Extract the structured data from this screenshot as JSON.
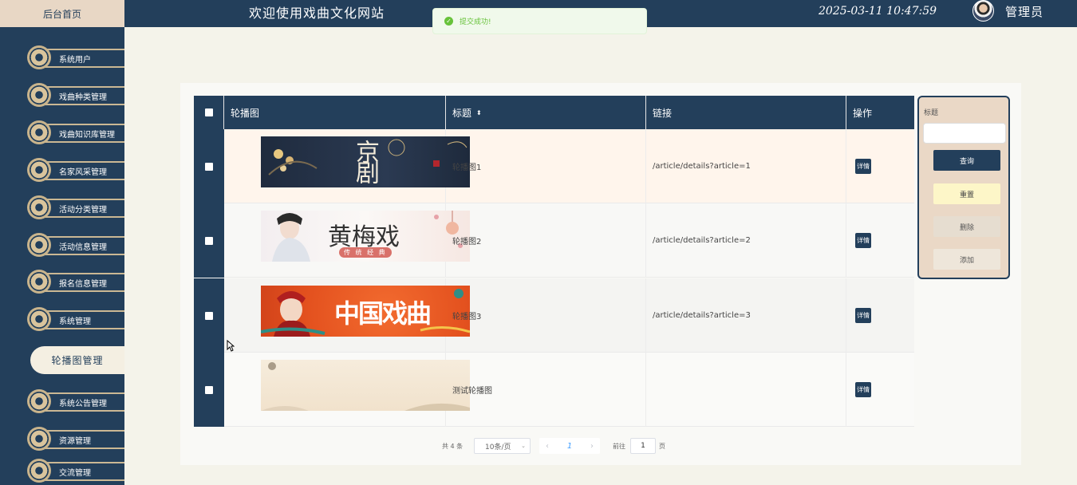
{
  "header": {
    "home_label": "后台首页",
    "site_title": "欢迎使用戏曲文化网站",
    "datetime": "2025-03-11 10:47:59",
    "user_label": "管理员"
  },
  "toast": {
    "message": "提交成功!"
  },
  "sidebar": {
    "items": [
      {
        "label": "系统用户"
      },
      {
        "label": "戏曲种类管理"
      },
      {
        "label": "戏曲知识库管理"
      },
      {
        "label": "名家风采管理"
      },
      {
        "label": "活动分类管理"
      },
      {
        "label": "活动信息管理"
      },
      {
        "label": "报名信息管理"
      },
      {
        "label": "系统管理"
      },
      {
        "label": "轮播图管理",
        "active": true
      },
      {
        "label": "系统公告管理"
      },
      {
        "label": "资源管理"
      },
      {
        "label": "交流管理"
      }
    ]
  },
  "table": {
    "columns": [
      "轮播图",
      "标题",
      "链接",
      "操作"
    ],
    "sort_icon": "sort-icon",
    "rows": [
      {
        "banner_text": "京剧",
        "title": "轮播图1",
        "link": "/article/details?article=1",
        "action": "详情"
      },
      {
        "banner_text": "黄梅戏",
        "banner_sub": "传 统 经 典",
        "title": "轮播图2",
        "link": "/article/details?article=2",
        "action": "详情"
      },
      {
        "banner_text": "中国戏曲",
        "title": "轮播图3",
        "link": "/article/details?article=3",
        "action": "详情"
      },
      {
        "banner_text": "",
        "title": "测试轮播图",
        "link": "",
        "action": "详情"
      }
    ]
  },
  "search": {
    "label": "标题",
    "input_value": "",
    "query_btn": "查询",
    "reset_btn": "重置",
    "delete_btn": "删除",
    "add_btn": "添加"
  },
  "pager": {
    "total": "共 4 条",
    "page_size": "10条/页",
    "current_page": "1",
    "goto_label": "前往",
    "goto_value": "1",
    "page_suffix": "页"
  },
  "colors": {
    "navy": "#233f5b",
    "beige": "#ead8c6",
    "reset_yellow": "#fdf6c8",
    "success_green": "#67c23a"
  }
}
